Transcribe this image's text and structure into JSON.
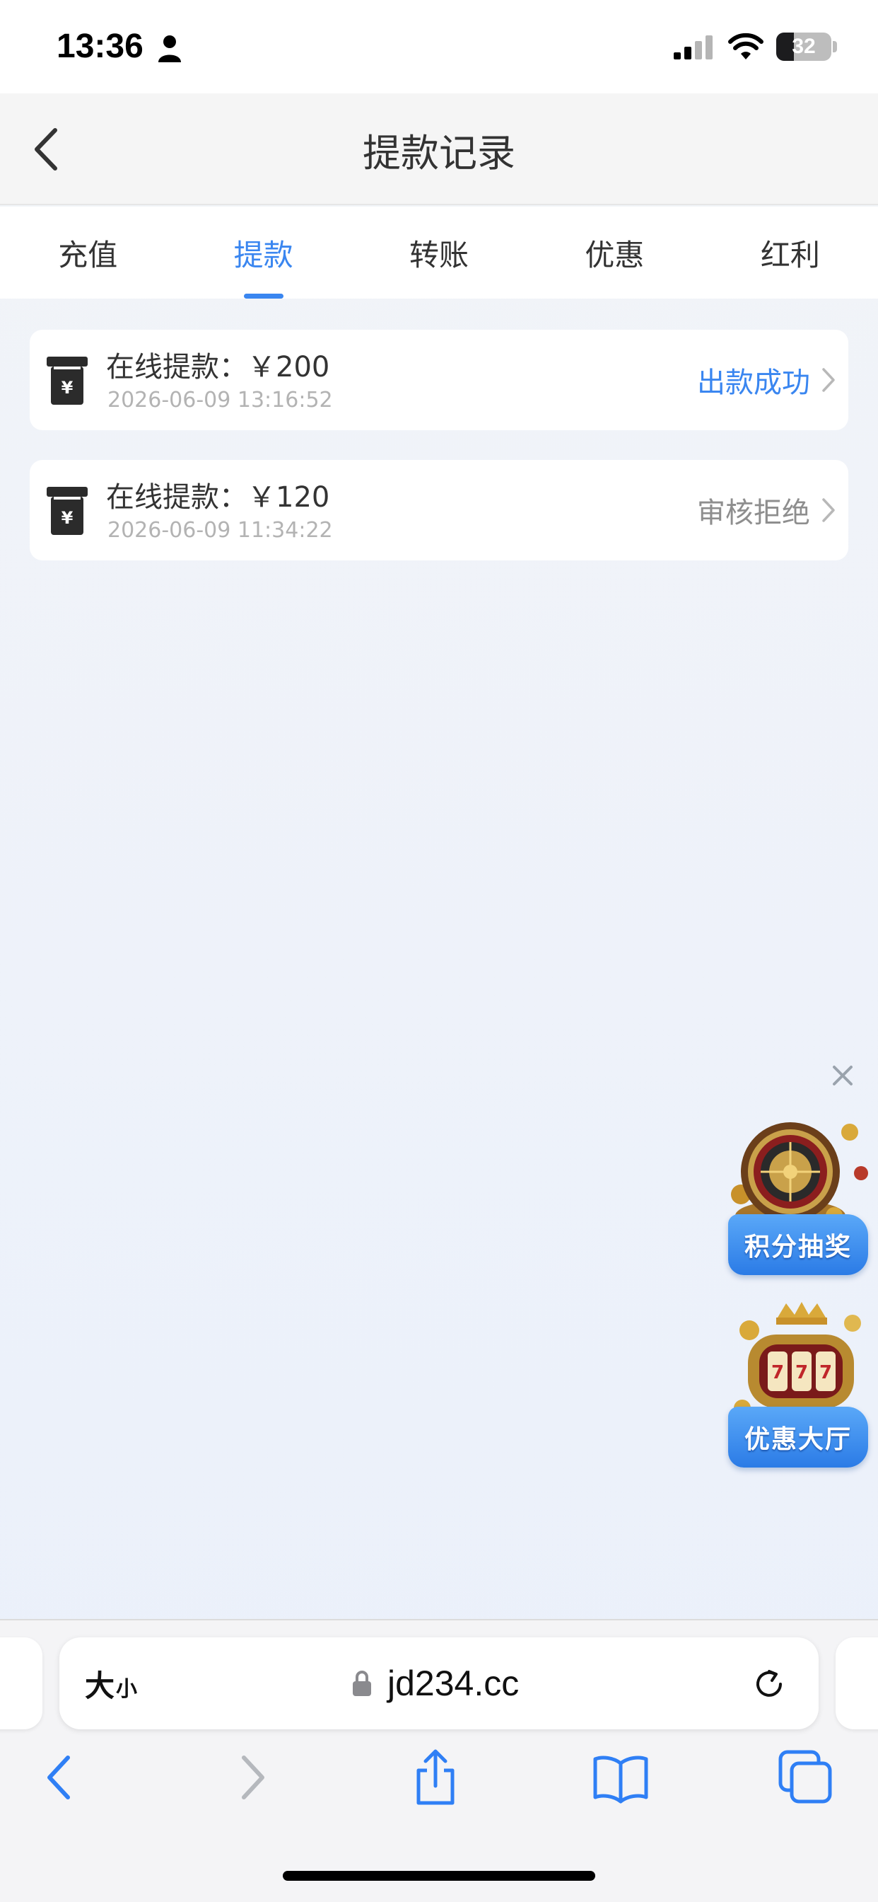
{
  "status_bar": {
    "time": "13:36",
    "battery": "32",
    "battery_level": 0.32,
    "icons": [
      "person-icon",
      "signal-icon",
      "wifi-icon",
      "battery-icon"
    ]
  },
  "header": {
    "title": "提款记录",
    "back_icon": "chevron-left-icon"
  },
  "tabs": [
    {
      "label": "充值",
      "active": false
    },
    {
      "label": "提款",
      "active": true
    },
    {
      "label": "转账",
      "active": false
    },
    {
      "label": "优惠",
      "active": false
    },
    {
      "label": "红利",
      "active": false
    }
  ],
  "records": [
    {
      "title": "在线提款：￥200",
      "time": "2026-06-09 13:16:52",
      "status": "出款成功",
      "status_color": "#3a86f0",
      "icon": "atm-yen-icon"
    },
    {
      "title": "在线提款：￥120",
      "time": "2026-06-09 11:34:22",
      "status": "审核拒绝",
      "status_color": "#8e8e8e",
      "icon": "atm-yen-icon"
    }
  ],
  "promos": [
    {
      "label": "积分抽奖",
      "icon": "roulette-icon"
    },
    {
      "label": "优惠大厅",
      "icon": "slot-machine-icon"
    }
  ],
  "browser": {
    "text_size_big": "大",
    "text_size_small": "小",
    "url": "jd234.cc",
    "icons": [
      "lock-icon",
      "reload-icon",
      "back-icon",
      "forward-icon",
      "share-icon",
      "bookmarks-icon",
      "tabs-icon"
    ]
  },
  "colors": {
    "accent": "#3a86f0",
    "rejected": "#8e8e8e",
    "promo_label": "#2b7be6"
  }
}
